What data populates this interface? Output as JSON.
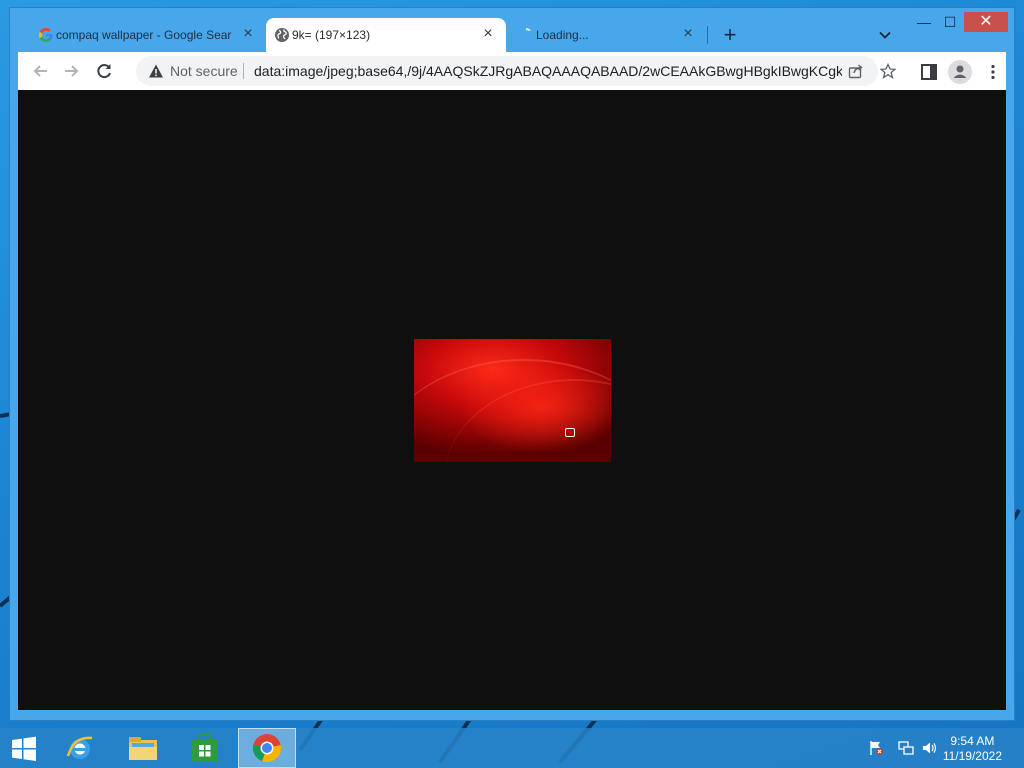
{
  "browser": {
    "tabs": [
      {
        "title": "compaq wallpaper - Google Sear",
        "favicon": "google-g-icon",
        "state": "inactive"
      },
      {
        "title": "9k= (197×123)",
        "favicon": "globe-icon",
        "state": "active"
      },
      {
        "title": "Loading...",
        "favicon": "loading-spinner-icon",
        "state": "inactive"
      }
    ],
    "tab_close_glyph": "×",
    "new_tab_glyph": "+",
    "window_controls": {
      "minimize": "—",
      "maximize": "☐",
      "close": "✕"
    },
    "toolbar": {
      "security_label": "Not secure",
      "url": "data:image/jpeg;base64,/9j/4AAQSkZJRgABAQAAAQABAAD/2wCEAAkGBwgHBgkIBwgKCgkL..."
    }
  },
  "content": {
    "image": {
      "description_icon": "compaq-wallpaper-image",
      "natural_size": "197×123"
    }
  },
  "taskbar": {
    "apps": [
      {
        "name": "start-button"
      },
      {
        "name": "internet-explorer"
      },
      {
        "name": "file-explorer"
      },
      {
        "name": "windows-store"
      },
      {
        "name": "chrome",
        "active": true
      }
    ],
    "clock": {
      "time": "9:54 AM",
      "date": "11/19/2022"
    }
  },
  "colors": {
    "desktop": "#1f8ad6",
    "window_frame": "#48a6ea",
    "close_button": "#c7504a",
    "viewer_background": "#0f0f10"
  }
}
